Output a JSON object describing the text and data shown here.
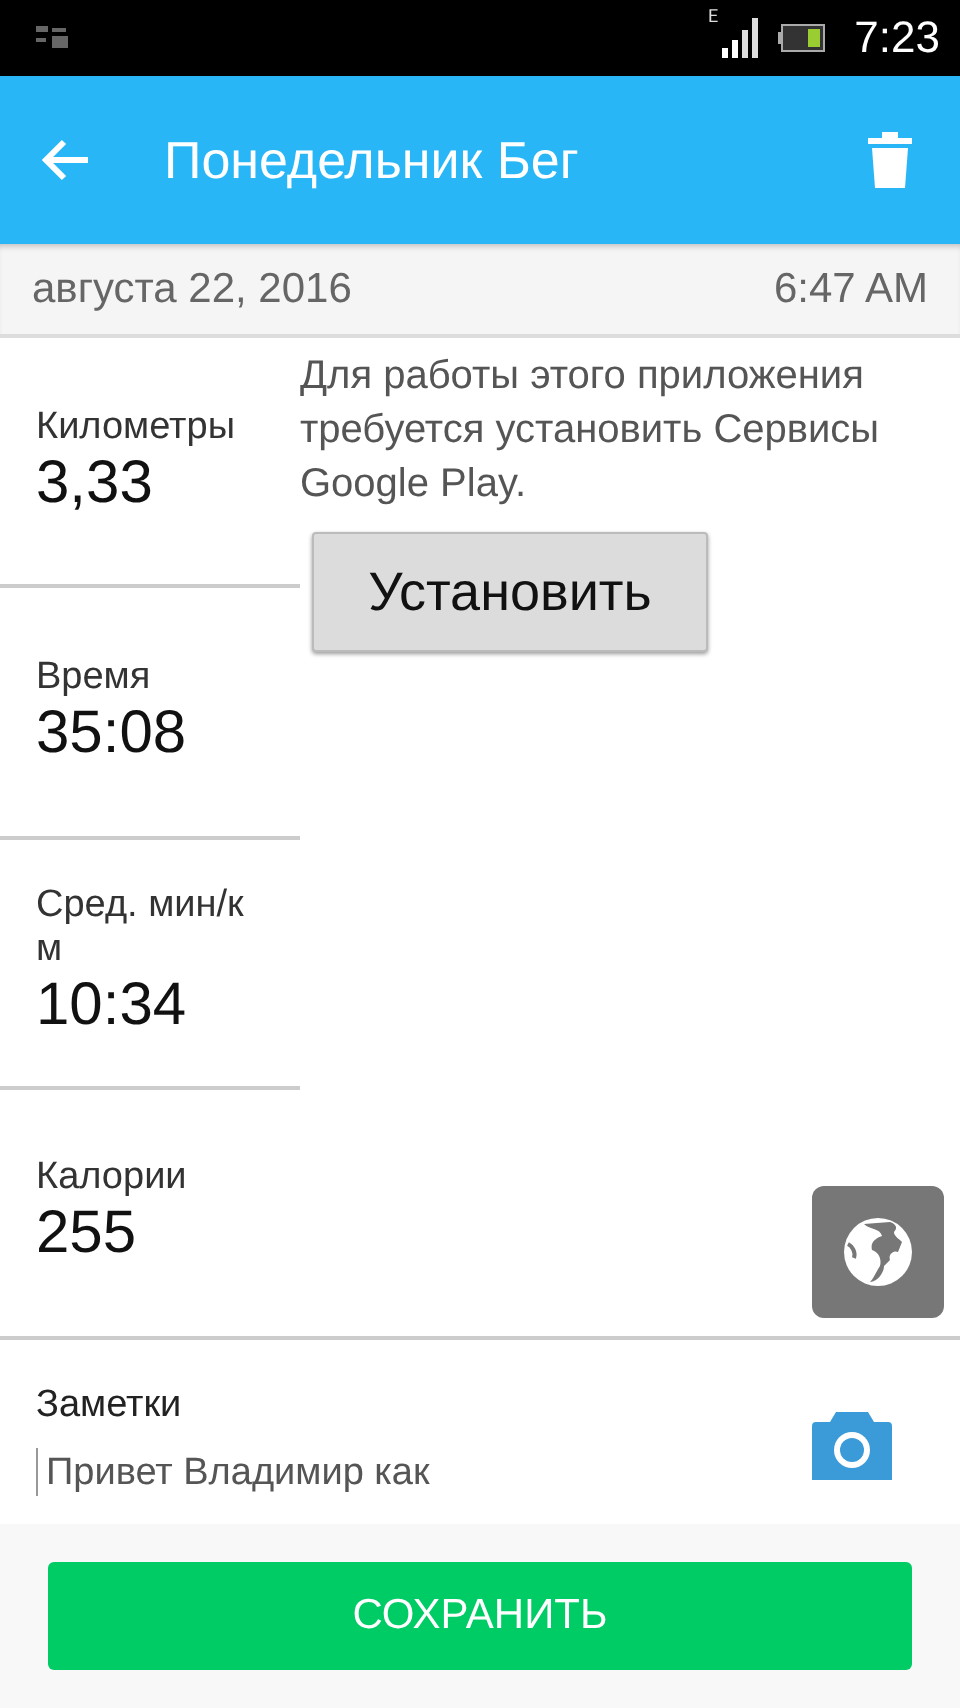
{
  "status_bar": {
    "time": "7:23",
    "network": "E"
  },
  "app_bar": {
    "title": "Понедельник Бег"
  },
  "date_row": {
    "date": "августа 22, 2016",
    "time": "6:47 AM"
  },
  "stats": [
    {
      "label": "Километры",
      "value": "3,33"
    },
    {
      "label": "Время",
      "value": "35:08"
    },
    {
      "label": "Сред. мин/км",
      "value": "10:34"
    },
    {
      "label": "Калории",
      "value": "255"
    }
  ],
  "map": {
    "message": "Для работы этого приложения требуется установить Сервисы Google Play.",
    "install_button": "Установить"
  },
  "notes": {
    "label": "Заметки",
    "value": "Привет Владимир как"
  },
  "save_button": "СОХРАНИТЬ"
}
